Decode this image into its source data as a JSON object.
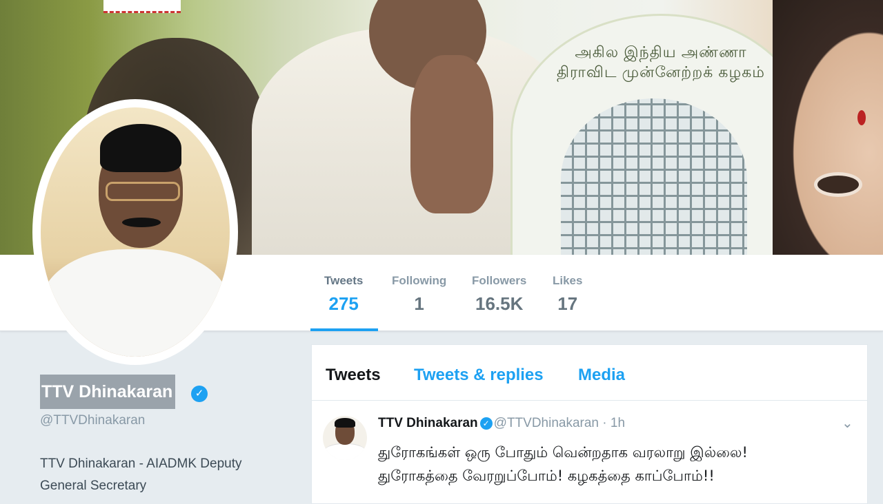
{
  "banner": {
    "arch_caption": "அகில இந்திய அண்ணா திராவிட முன்னேற்றக் கழகம்"
  },
  "stats": [
    {
      "label": "Tweets",
      "value": "275"
    },
    {
      "label": "Following",
      "value": "1"
    },
    {
      "label": "Followers",
      "value": "16.5K"
    },
    {
      "label": "Likes",
      "value": "17"
    }
  ],
  "profile": {
    "name": "TTV Dhinakaran",
    "handle": "@TTVDhinakaran",
    "bio_line1": "TTV Dhinakaran - AIADMK Deputy",
    "bio_line2": "General Secretary",
    "verified_glyph": "✓"
  },
  "tabs": [
    {
      "label": "Tweets"
    },
    {
      "label": "Tweets & replies"
    },
    {
      "label": "Media"
    }
  ],
  "tweet": {
    "author_name": "TTV Dhinakaran",
    "author_handle": "@TTVDhinakaran",
    "separator": "·",
    "time": "1h",
    "line1": "துரோகங்கள் ஒரு போதும் வென்றதாக வரலாறு இல்லை!",
    "line2": "துரோகத்தை வேரறுப்போம்! கழகத்தை காப்போம்!!",
    "caret": "⌄"
  },
  "colors": {
    "accent": "#1da1f2",
    "muted": "#8899a6",
    "text": "#14171a"
  }
}
